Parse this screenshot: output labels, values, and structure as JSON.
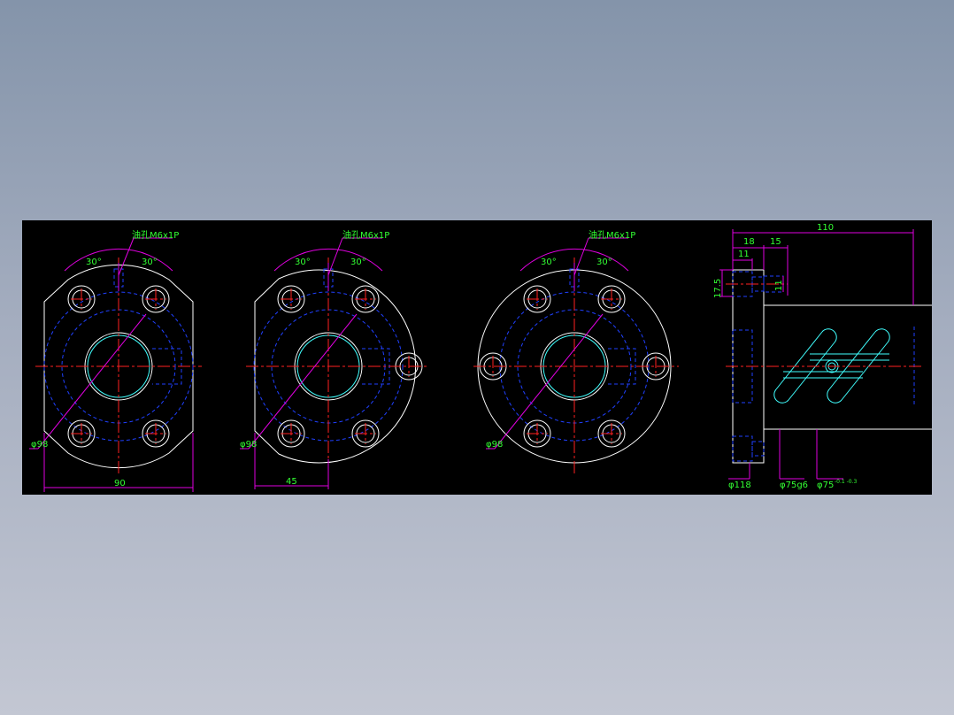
{
  "colors": {
    "background": "#000000",
    "outline": "#ffffff",
    "hidden_line": "#2040ff",
    "center_line": "#ff2020",
    "dimension_line": "#e000e0",
    "dimension_text": "#33ff33",
    "thread_line": "#40ffff"
  },
  "views": {
    "view1": {
      "oil_hole": "油孔M6x1P",
      "angle_left": "30°",
      "angle_right": "30°",
      "pcd": "φ98",
      "width": "90"
    },
    "view2": {
      "oil_hole": "油孔M6x1P",
      "angle_left": "30°",
      "angle_right": "30°",
      "pcd": "φ98",
      "half_width": "45"
    },
    "view3": {
      "oil_hole": "油孔M6x1P",
      "angle_left": "30°",
      "angle_right": "30°",
      "pcd": "φ98"
    },
    "side": {
      "total_length": "110",
      "flange_thickness": "18",
      "offset": "15",
      "hole_depth": "11",
      "hole_height": "17.5",
      "hole_dia": "11",
      "flange_dia": "φ118",
      "pilot_dia": "φ75g6",
      "body_dia": "φ75",
      "body_tol": "-0.1 -0.3"
    }
  }
}
